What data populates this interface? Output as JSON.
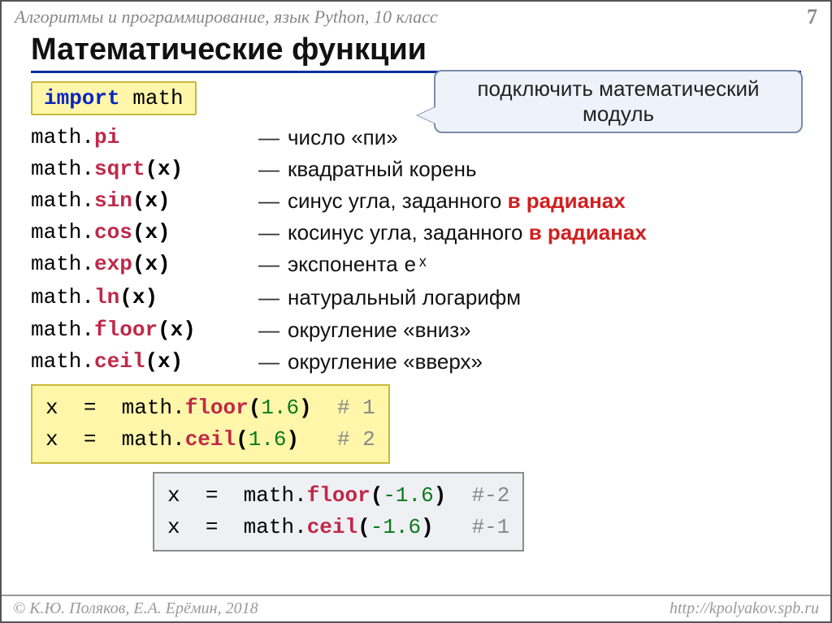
{
  "header": {
    "subject": "Алгоритмы и программирование, язык Python, 10 класс",
    "page": "7"
  },
  "title": "Математические функции",
  "import_line": {
    "kw": "import",
    "mod": "math"
  },
  "callout": "подключить математический модуль",
  "rows": [
    {
      "mod": "math",
      "dot": ".",
      "attr": "pi",
      "args": "",
      "desc_pre": "число «пи»",
      "desc_red": "",
      "sup": ""
    },
    {
      "mod": "math",
      "dot": ".",
      "attr": "sqrt",
      "args": "(x)",
      "desc_pre": "квадратный корень",
      "desc_red": "",
      "sup": ""
    },
    {
      "mod": "math",
      "dot": ".",
      "attr": "sin",
      "args": "(x)",
      "desc_pre": "синус угла, заданного ",
      "desc_red": "в радианах",
      "sup": ""
    },
    {
      "mod": "math",
      "dot": ".",
      "attr": "cos",
      "args": "(x)",
      "desc_pre": "косинус угла, заданного ",
      "desc_red": "в радианах",
      "sup": ""
    },
    {
      "mod": "math",
      "dot": ".",
      "attr": "exp",
      "args": "(x)",
      "desc_pre": "экспонента ",
      "desc_red": "",
      "sup": "eˣ"
    },
    {
      "mod": "math",
      "dot": ".",
      "attr": "ln",
      "args": "(x)",
      "desc_pre": "натуральный логарифм",
      "desc_red": "",
      "sup": ""
    },
    {
      "mod": "math",
      "dot": ".",
      "attr": "floor",
      "args": "(x)",
      "desc_pre": "округление «вниз»",
      "desc_red": "",
      "sup": ""
    },
    {
      "mod": "math",
      "dot": ".",
      "attr": "ceil",
      "args": "(x)",
      "desc_pre": "округление «вверх»",
      "desc_red": "",
      "sup": ""
    }
  ],
  "example1": [
    {
      "lhs": "x",
      "eq": "=",
      "mod": "math",
      "attr": "floor",
      "arg": "1.6",
      "comment": "# 1"
    },
    {
      "lhs": "x",
      "eq": "=",
      "mod": "math",
      "attr": "ceil",
      "arg": "1.6",
      "comment": "# 2"
    }
  ],
  "example2": [
    {
      "lhs": "x",
      "eq": "=",
      "mod": "math",
      "attr": "floor",
      "arg": "-1.6",
      "comment": "#-2"
    },
    {
      "lhs": "x",
      "eq": "=",
      "mod": "math",
      "attr": "ceil",
      "arg": "-1.6",
      "comment": "#-1"
    }
  ],
  "footer": {
    "left": "© К.Ю. Поляков, Е.А. Ерёмин, 2018",
    "right": "http://kpolyakov.spb.ru"
  }
}
